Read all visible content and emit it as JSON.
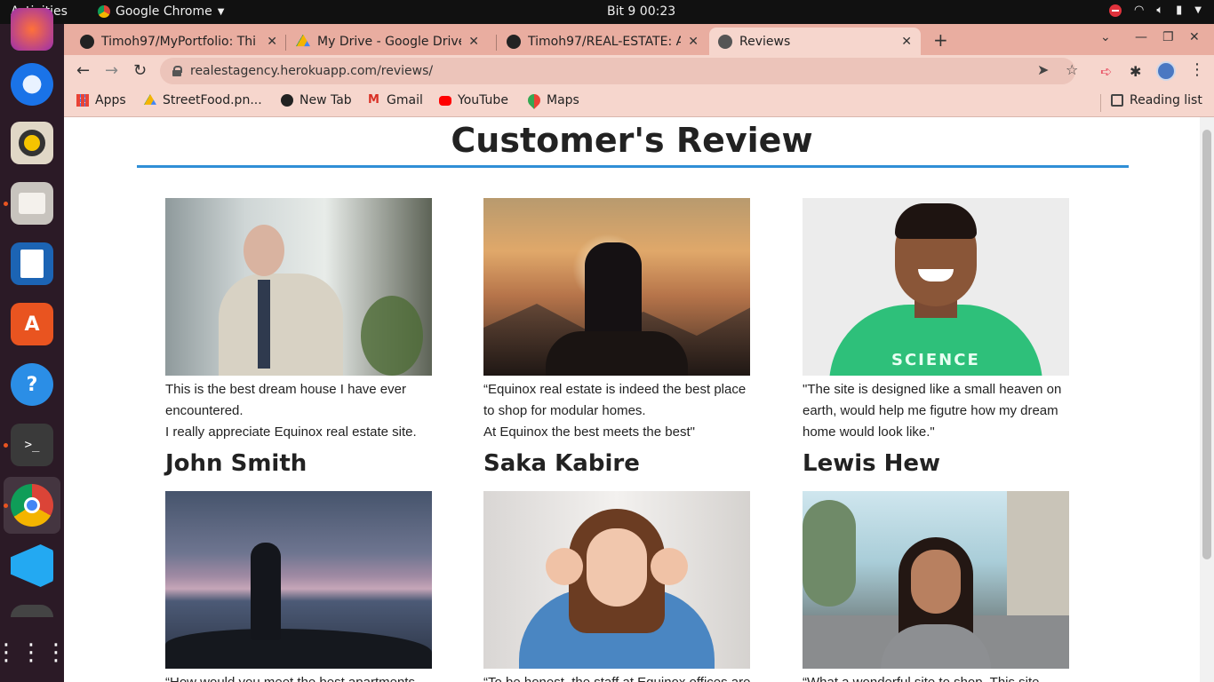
{
  "system": {
    "activities": "Activities",
    "app_name": "Google Chrome",
    "clock": "Bit 9  00:23"
  },
  "dock": {
    "apps": [
      "firefox-icon",
      "thunderbird-icon",
      "rhythmbox-icon",
      "files-icon",
      "writer-icon",
      "software-icon",
      "help-icon",
      "terminal-icon",
      "chrome-icon",
      "vscode-icon",
      "app-grid-icon"
    ]
  },
  "browser": {
    "tabs": [
      {
        "title": "Timoh97/MyPortfolio: Thi",
        "icon": "github-icon"
      },
      {
        "title": "My Drive - Google Drive",
        "icon": "google-drive-icon"
      },
      {
        "title": "Timoh97/REAL-ESTATE: A",
        "icon": "github-icon"
      },
      {
        "title": "Reviews",
        "icon": "globe-icon"
      }
    ],
    "url": "realestagency.herokuapp.com/reviews/",
    "bookmarks": [
      {
        "label": "Apps",
        "icon": "apps-grid-icon"
      },
      {
        "label": "StreetFood.pn...",
        "icon": "google-drive-icon"
      },
      {
        "label": "New Tab",
        "icon": "globe-icon"
      },
      {
        "label": "Gmail",
        "icon": "gmail-icon"
      },
      {
        "label": "YouTube",
        "icon": "youtube-icon"
      },
      {
        "label": "Maps",
        "icon": "maps-icon"
      }
    ],
    "reading_list": "Reading list",
    "accent_color": "#e9ada0"
  },
  "page": {
    "title": "Customer's Review",
    "rule_color": "#2f8fd6",
    "reviews": [
      {
        "quote_lines": [
          "This is the best dream house I have ever",
          "encountered.",
          "I really appreciate Equinox real estate site."
        ],
        "name": "John Smith"
      },
      {
        "quote_lines": [
          "“Equinox real estate is indeed the best place",
          "to shop for modular homes.",
          "At Equinox the best meets the best\""
        ],
        "name": "Saka Kabire"
      },
      {
        "quote_lines": [
          "\"The site is designed like a small heaven on",
          "earth, would help me figutre how my dream",
          "home would look like.\""
        ],
        "name": "Lewis Hew"
      },
      {
        "quote_lines": [
          "“How would you meet the best apartments"
        ]
      },
      {
        "quote_lines": [
          "“To be honest, the staff at Equinox offices are"
        ]
      },
      {
        "quote_lines": [
          "“What a wonderful site to shop. This site"
        ]
      }
    ],
    "photo_texts": {
      "shirt_print": "SCIENCE"
    }
  }
}
